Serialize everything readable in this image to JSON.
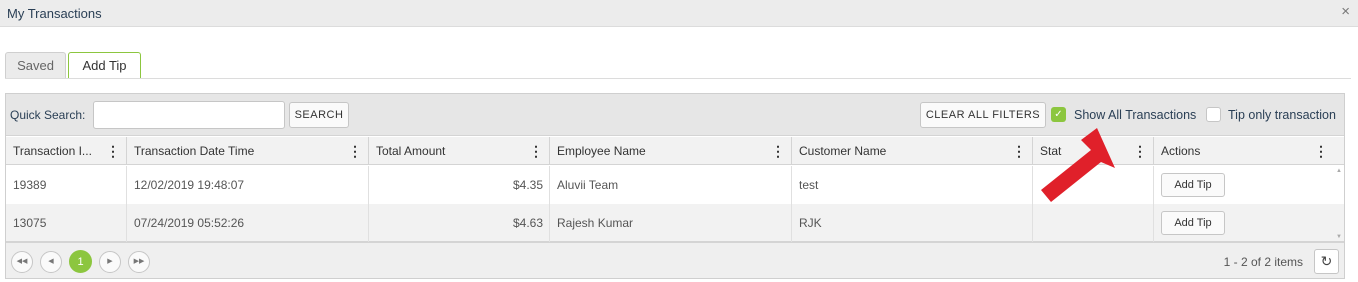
{
  "window": {
    "title": "My Transactions",
    "close_glyph": "×"
  },
  "tabs": [
    {
      "label": "Saved",
      "active": false
    },
    {
      "label": "Add Tip",
      "active": true
    }
  ],
  "toolbar": {
    "quick_search_label": "Quick Search:",
    "quick_search_value": "",
    "search_button": "SEARCH",
    "clear_filters_button": "CLEAR ALL FILTERS",
    "show_all_label": "Show All Transactions",
    "show_all_checked": true,
    "tip_only_label": "Tip only transaction",
    "tip_only_checked": false
  },
  "table": {
    "columns": [
      "Transaction I...",
      "Transaction Date Time",
      "Total Amount",
      "Employee Name",
      "Customer Name",
      "Stat",
      "Actions"
    ],
    "rows": [
      {
        "id": "19389",
        "date": "12/02/2019 19:48:07",
        "amount": "$4.35",
        "employee": "Aluvii Team",
        "customer": "test",
        "status": "",
        "action": "Add Tip"
      },
      {
        "id": "13075",
        "date": "07/24/2019 05:52:26",
        "amount": "$4.63",
        "employee": "Rajesh Kumar",
        "customer": "RJK",
        "status": "",
        "action": "Add Tip"
      }
    ]
  },
  "pager": {
    "first": "◀◀",
    "prev": "◀",
    "current_page": "1",
    "next": "▶",
    "last": "▶▶",
    "info": "1 - 2 of 2 items",
    "refresh_glyph": "↻"
  },
  "colors": {
    "accent": "#8cc63f",
    "annotation_arrow": "#e0202a",
    "title_text": "#2a3f55"
  },
  "icons": {
    "close": "close-icon",
    "checkbox": "check-icon",
    "column_menu": "column-menu-icon",
    "refresh": "refresh-icon",
    "annotation": "red-arrow-icon"
  }
}
